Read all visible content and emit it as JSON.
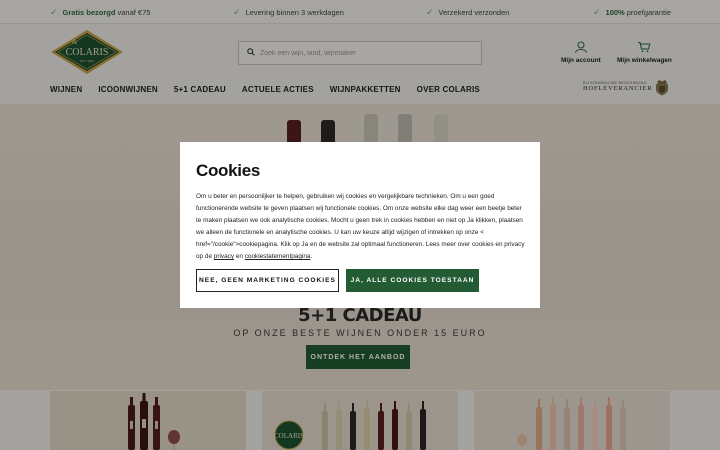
{
  "usp": {
    "items": [
      {
        "bold": "Gratis bezorgd",
        "text": "vanaf €75"
      },
      {
        "bold": "",
        "text": "Levering binnen 3 werkdagen"
      },
      {
        "bold": "",
        "text": "Verzekerd verzonden"
      },
      {
        "bold": "100%",
        "text": "proefgarantie"
      }
    ]
  },
  "header": {
    "logo_text": "COLARIS",
    "logo_sub": "EST. 1960",
    "search_placeholder": "Zoek een wijn, land, wijnmaker",
    "account_label": "Mijn account",
    "cart_label": "Mijn winkelwagen",
    "royal_small": "BIJ KONINKLIJKE BESCHIKKING",
    "royal_big": "HOFLEVERANCIER"
  },
  "nav": {
    "items": [
      "WIJNEN",
      "ICOONWIJNEN",
      "5+1 CADEAU",
      "ACTUELE ACTIES",
      "WIJNPAKKETTEN",
      "OVER COLARIS"
    ]
  },
  "hero": {
    "title": "5+1 CADEAU",
    "subtitle": "OP ONZE BESTE WIJNEN ONDER 15 EURO",
    "button": "ONTDEK HET AANBOD"
  },
  "cookie": {
    "title": "Cookies",
    "body": "Om u beter en persoonlijker te helpen, gebruiken wij cookies en vergelijkbare technieken. Om u een goed functionerende website te geven plaatsen wij functionele cookies. Om onze website elke dag weer een beetje beter te maken plaatsen we ook analytische cookies. Mocht u geen trek in cookies hebben en niet op Ja klikken, plaatsen we alleen de functionele en analytische cookies. U kan uw keuze altijd wijzigen of intrekken op onze < href=\"/cookie\">cookiepagina. Klik op Ja en de website zal optimaal functioneren. Lees meer over cookies en privacy op de ",
    "link_privacy": "privacy",
    "link_join": " en ",
    "link_statement": "cookiestatementpagina",
    "body_end": ".",
    "btn_decline": "NEE, GEEN MARKETING COOKIES",
    "btn_accept": "JA, ALLE COOKIES TOESTAAN"
  },
  "colors": {
    "brand_green": "#235c34",
    "usp_green": "#2f6b3e",
    "logo_gold": "#c9a449"
  }
}
